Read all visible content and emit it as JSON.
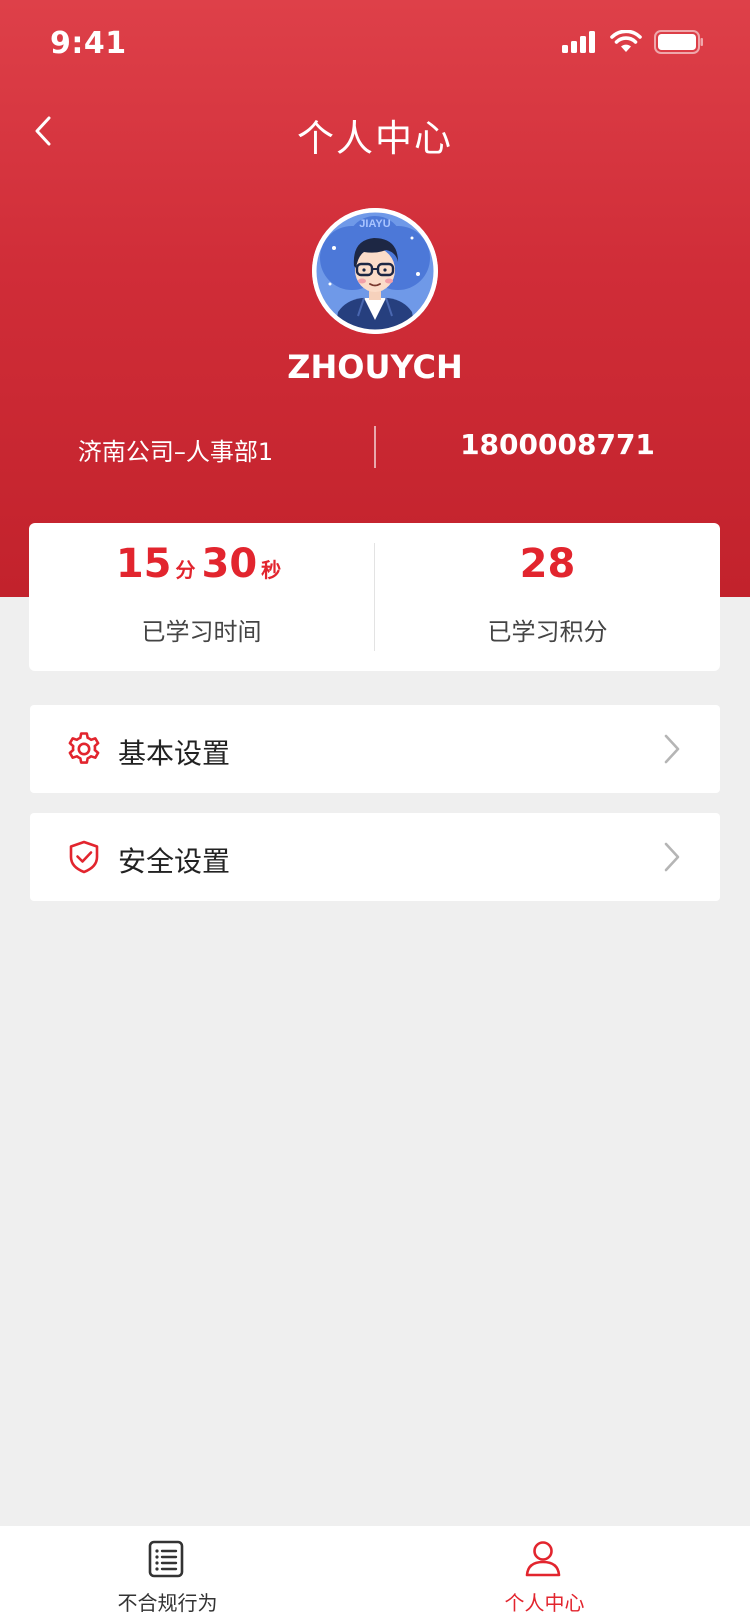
{
  "status_bar": {
    "time": "9:41"
  },
  "nav": {
    "title": "个人中心",
    "back_icon": "chevron-left-icon"
  },
  "profile": {
    "username": "ZHOUYCH",
    "avatar_text": "JIAYU",
    "department": "济南公司–人事部1",
    "phone": "1800008771"
  },
  "stats": {
    "study_time": {
      "minutes": "15",
      "minutes_unit": "分",
      "seconds": "30",
      "seconds_unit": "秒",
      "label": "已学习时间"
    },
    "points": {
      "value": "28",
      "label": "已学习积分"
    }
  },
  "menu": {
    "items": [
      {
        "label": "基本设置",
        "icon": "gear-icon"
      },
      {
        "label": "安全设置",
        "icon": "shield-check-icon"
      }
    ]
  },
  "tabs": [
    {
      "label": "不合规行为",
      "icon": "document-list-icon",
      "active": false
    },
    {
      "label": "个人中心",
      "icon": "user-icon",
      "active": true
    }
  ],
  "colors": {
    "brand_red": "#e2252e",
    "hero_top": "#de4049",
    "hero_bottom": "#c2222c",
    "background": "#efefef"
  }
}
